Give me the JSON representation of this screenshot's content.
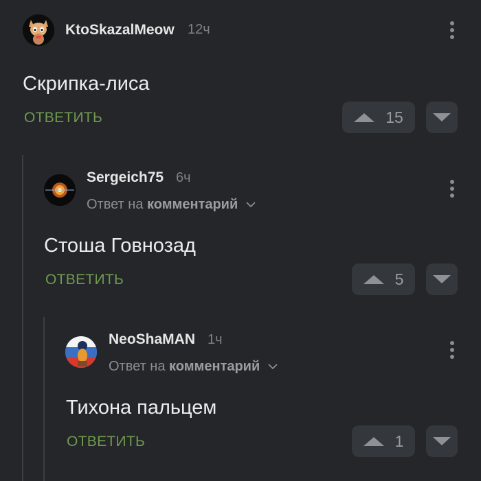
{
  "comments": [
    {
      "username": "KtoSkazalMeow",
      "time": "12ч",
      "text": "Скрипка-лиса",
      "reply_label": "ОТВЕТИТЬ",
      "votes": "15"
    },
    {
      "username": "Sergeich75",
      "time": "6ч",
      "reply_to_prefix": "Ответ на",
      "reply_to_target": "комментарий",
      "text": "Стоша Говнозад",
      "reply_label": "ОТВЕТИТЬ",
      "votes": "5"
    },
    {
      "username": "NeoShaMAN",
      "time": "1ч",
      "reply_to_prefix": "Ответ на",
      "reply_to_target": "комментарий",
      "text": "Тихона пальцем",
      "reply_label": "ОТВЕТИТЬ",
      "votes": "1"
    }
  ],
  "colors": {
    "background": "#24262a",
    "reply_green": "#6f9a4f",
    "vote_bg": "#34373c"
  },
  "icons": {
    "menu": "kebab-menu-icon",
    "upvote": "upvote-arrow-icon",
    "downvote": "downvote-arrow-icon",
    "expand": "chevron-down-icon"
  }
}
